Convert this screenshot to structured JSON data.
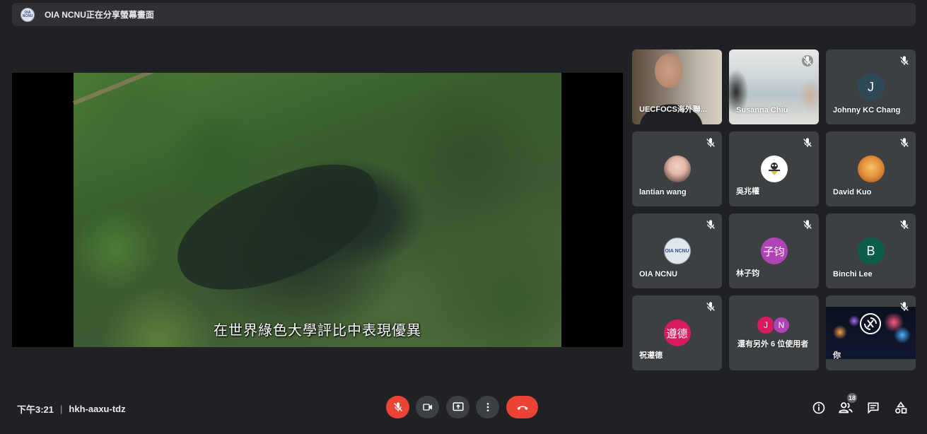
{
  "banner": {
    "text": "OIA NCNU正在分享螢幕畫面",
    "logo_text": "OIA NCNU"
  },
  "stage": {
    "subtitle": "在世界綠色大學評比中表現優異"
  },
  "participants": [
    {
      "name": "UECFOCS海外聯...",
      "type": "video",
      "muted": false
    },
    {
      "name": "Susanna Chiu",
      "type": "video",
      "muted": true
    },
    {
      "name": "Johnny KC Chang",
      "type": "initial",
      "initial": "J",
      "color": "#2f4a57",
      "muted": true
    },
    {
      "name": "lantian wang",
      "type": "photo",
      "muted": true
    },
    {
      "name": "吳兆權",
      "type": "photo",
      "muted": true
    },
    {
      "name": "David Kuo",
      "type": "photo",
      "muted": true
    },
    {
      "name": "OIA NCNU",
      "type": "logo",
      "logo_text": "OIA NCNU",
      "muted": true
    },
    {
      "name": "林子钧",
      "type": "initial",
      "initial": "子钧",
      "color": "#b043b6",
      "muted": true
    },
    {
      "name": "Binchi Lee",
      "type": "initial",
      "initial": "B",
      "color": "#0b5f4a",
      "muted": true
    },
    {
      "name": "祝遵德",
      "type": "initial",
      "initial": "遵德",
      "color": "#d81b60",
      "muted": true
    },
    {
      "name": "還有另外 6 位使用者",
      "type": "others",
      "initials": [
        "J",
        "N"
      ],
      "colors": [
        "#d81b60",
        "#b043b6"
      ],
      "muted": false
    },
    {
      "name": "你",
      "type": "video",
      "muted": true
    }
  ],
  "footer": {
    "time": "下午3:21",
    "separator": "|",
    "meeting_code": "hkh-aaxu-tdz",
    "participant_count": "18"
  },
  "icons": {
    "mic": "mic-off-icon",
    "camera": "camera-icon",
    "present": "present-screen-icon",
    "more": "more-vert-icon",
    "hangup": "hangup-icon",
    "info": "info-icon",
    "people": "people-icon",
    "chat": "chat-icon",
    "activities": "activities-icon"
  },
  "colors": {
    "background": "#202124",
    "tile": "#3c4043",
    "danger": "#ea4335"
  }
}
